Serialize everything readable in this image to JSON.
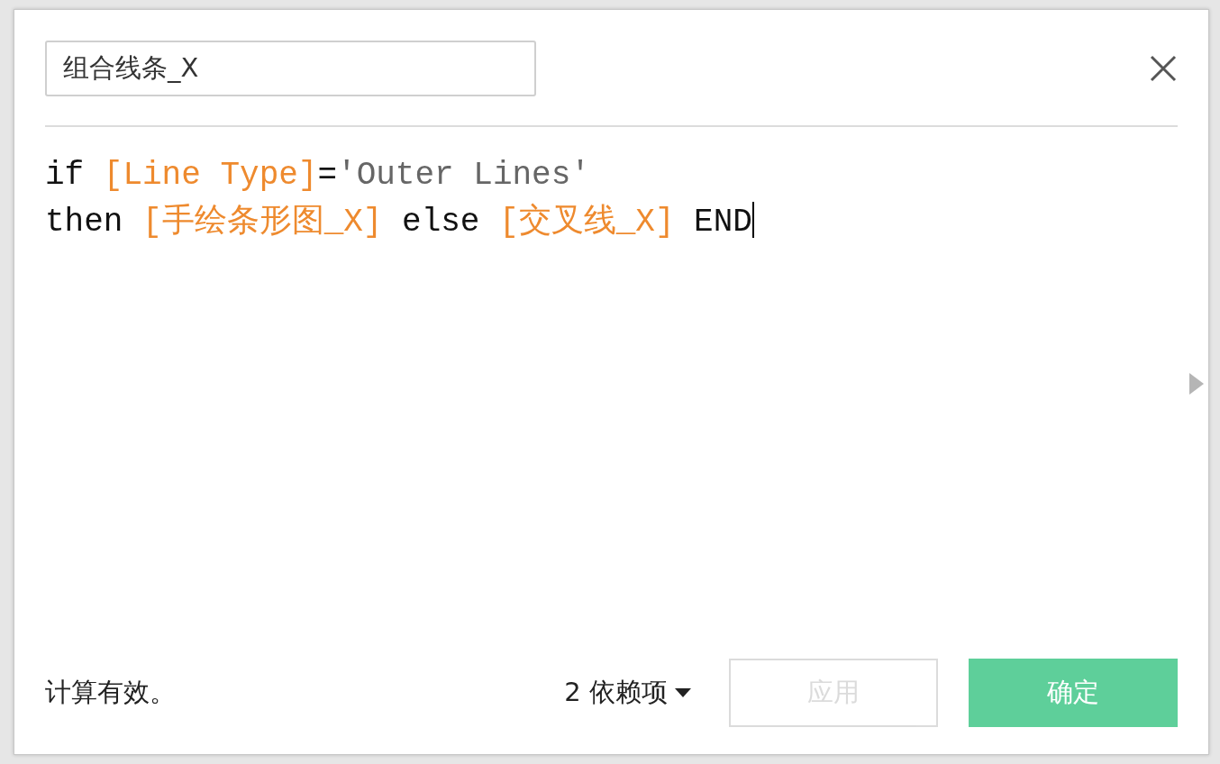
{
  "dialog": {
    "name_field": {
      "value": "组合线条_X"
    },
    "code": {
      "cursor_visible": true,
      "lines": [
        {
          "tokens": [
            {
              "kind": "keyword",
              "text": "if "
            },
            {
              "kind": "field",
              "text": "[Line Type]"
            },
            {
              "kind": "keyword",
              "text": "="
            },
            {
              "kind": "string",
              "text": "'Outer Lines'"
            }
          ]
        },
        {
          "tokens": [
            {
              "kind": "keyword",
              "text": "then "
            },
            {
              "kind": "field",
              "text": "[手绘条形图_X]"
            },
            {
              "kind": "keyword",
              "text": " else "
            },
            {
              "kind": "field",
              "text": "[交叉线_X]"
            },
            {
              "kind": "keyword",
              "text": " END"
            }
          ]
        }
      ]
    },
    "status": "计算有效。",
    "dependencies": "2 依赖项",
    "buttons": [
      {
        "kind": "secondary",
        "label": "应用",
        "disabled": true
      },
      {
        "kind": "primary",
        "label": "确定",
        "disabled": false
      }
    ]
  }
}
